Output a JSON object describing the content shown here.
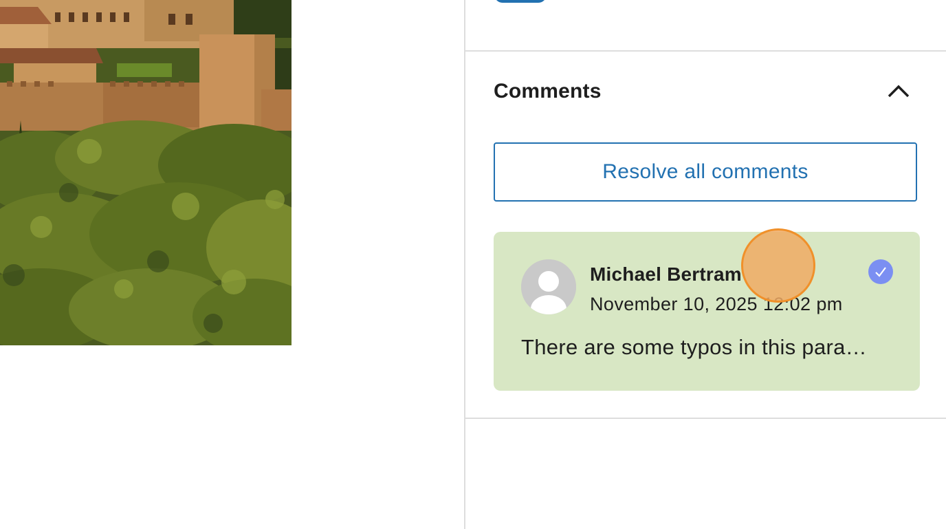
{
  "sidebar": {
    "comments_panel": {
      "title": "Comments",
      "resolve_all_label": "Resolve all comments",
      "comments": [
        {
          "author": "Michael Bertram",
          "date": "November 10, 2025 12:02 pm",
          "text": "There are some typos in this para…",
          "background": "#d8e7c4"
        }
      ]
    }
  },
  "colors": {
    "accent": "#2271b1",
    "resolve_check": "#7b8ff2",
    "cursor_highlight": "#f0902a"
  }
}
